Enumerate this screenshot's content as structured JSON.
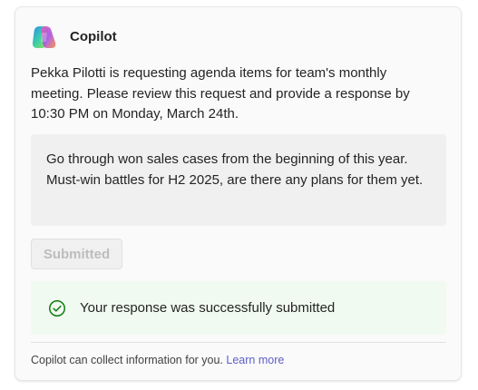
{
  "card": {
    "app_name": "Copilot",
    "logo_icon": "copilot-logo-icon",
    "request_text": "Pekka Pilotti is requesting agenda items for team's monthly meeting. Please review this request and provide a response by 10:30 PM on Monday, March 24th.",
    "response_text": "Go through won sales cases from the beginning of this year. Must-win battles for H2 2025, are there any plans for them yet.",
    "submit_button": {
      "label": "Submitted",
      "state": "disabled"
    },
    "success": {
      "icon": "check-circle-icon",
      "message": "Your response was successfully submitted",
      "color": "#107c10"
    },
    "footer": {
      "text": "Copilot can collect information for you.",
      "link_label": "Learn more",
      "link_color": "#5b5fc7"
    }
  }
}
